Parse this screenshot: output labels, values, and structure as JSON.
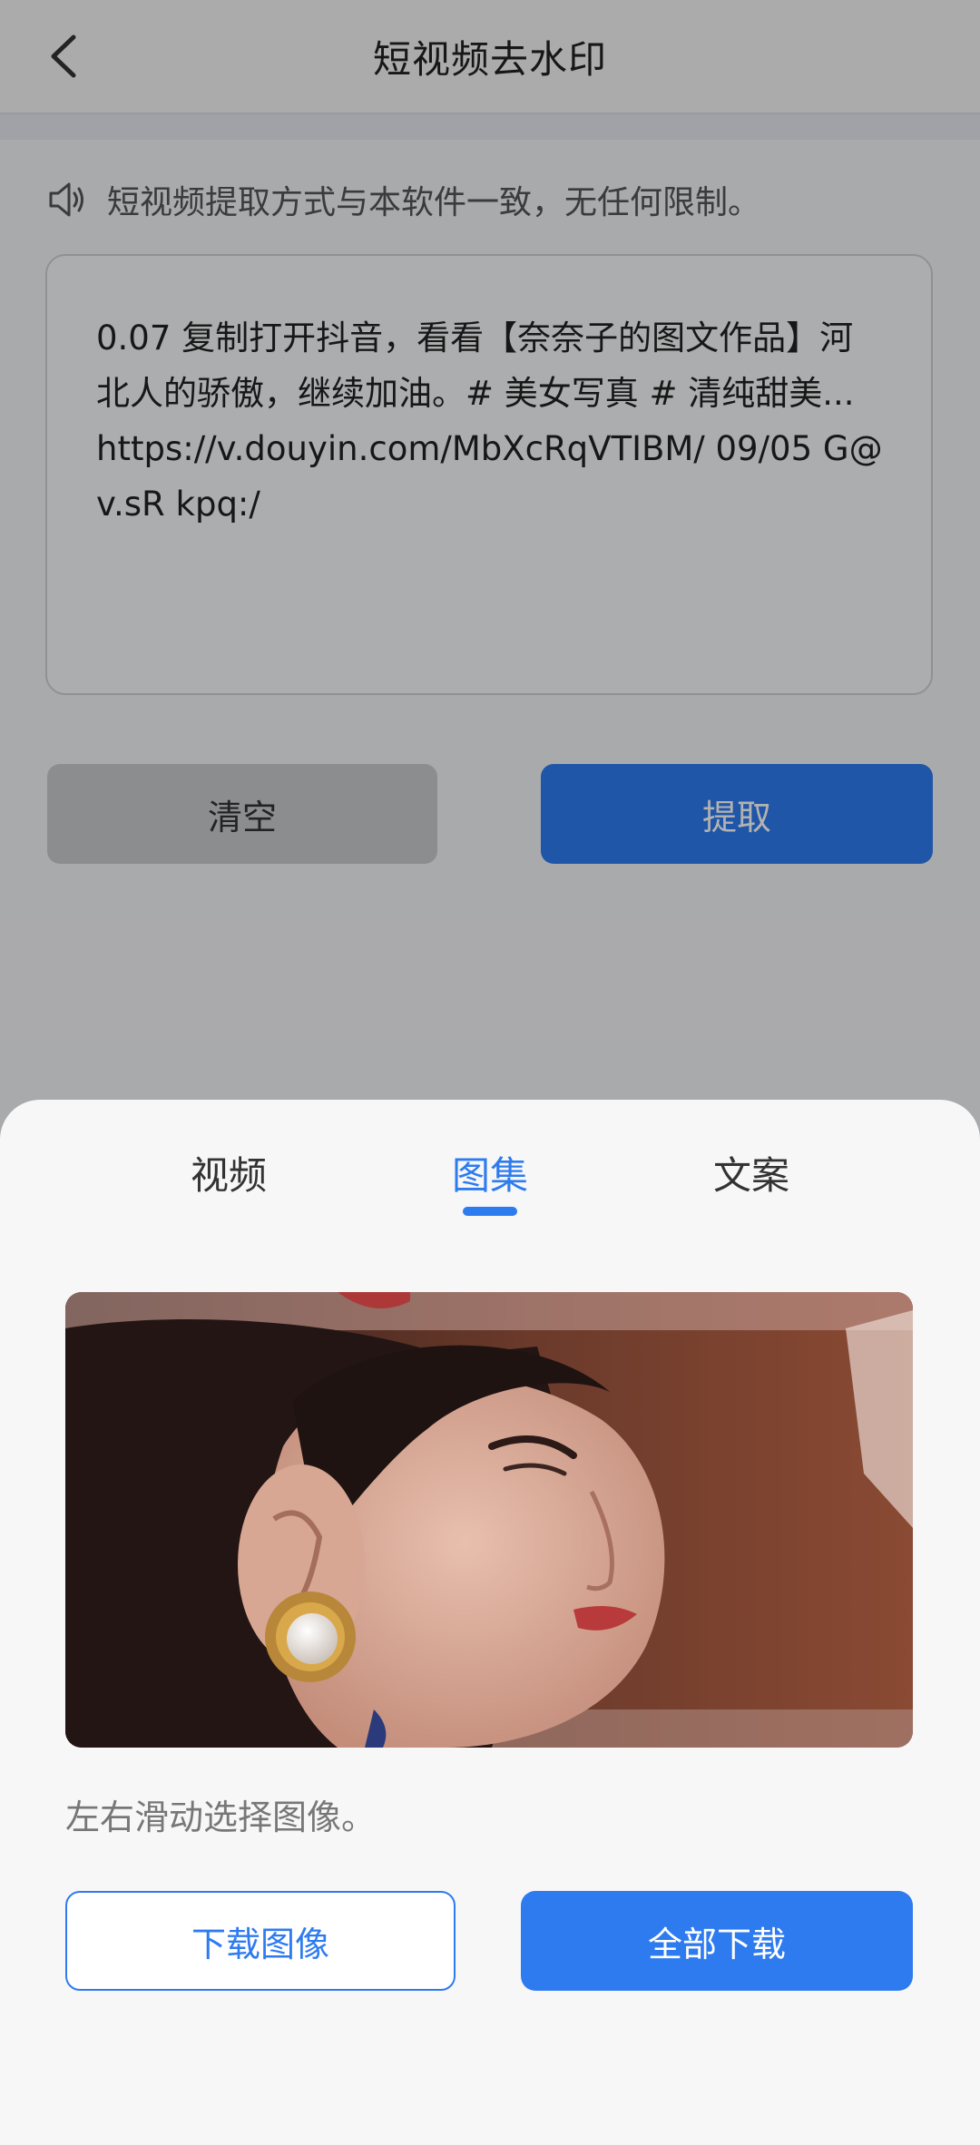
{
  "header": {
    "title": "短视频去水印",
    "back_icon": "chevron-left-icon"
  },
  "notice": {
    "icon": "speaker-icon",
    "text": "短视频提取方式与本软件一致，无任何限制。"
  },
  "link_input": {
    "value": "0.07 复制打开抖音，看看【奈奈子的图文作品】河北人的骄傲，继续加油。# 美女写真 # 清纯甜美... https://v.douyin.com/MbXcRqVTIBM/ 09/05 G@v.sR kpq:/"
  },
  "actions": {
    "clear_label": "清空",
    "extract_label": "提取"
  },
  "sheet": {
    "tabs": [
      {
        "label": "视频",
        "active": false
      },
      {
        "label": "图集",
        "active": true
      },
      {
        "label": "文案",
        "active": false
      }
    ],
    "hint": "左右滑动选择图像。",
    "download_image_label": "下载图像",
    "download_all_label": "全部下载"
  },
  "colors": {
    "accent": "#2e7bf0",
    "clear_button": "#c9cacd",
    "overlay": "rgba(0,0,0,0.30)"
  }
}
